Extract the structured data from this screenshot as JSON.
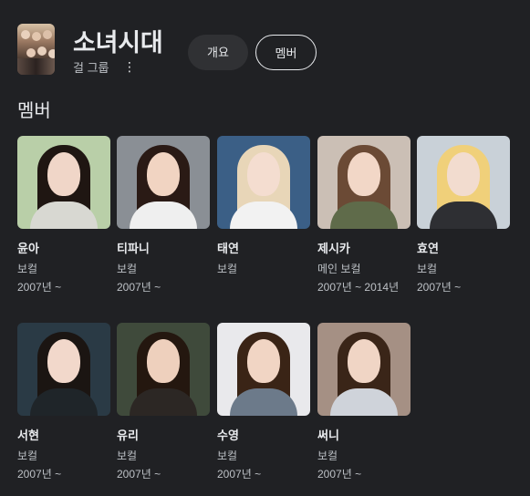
{
  "group": {
    "name": "소녀시대",
    "type": "걸 그룹",
    "more_icon": "⋮"
  },
  "chips": {
    "overview": "개요",
    "members": "멤버"
  },
  "section_title": "멤버",
  "members": [
    {
      "name": "윤아",
      "role": "보컬",
      "years": "2007년 ~",
      "bg": "#b9cfa8",
      "hair": "#1f1612",
      "face": "#f0d6c8",
      "body": "#d8d8d2"
    },
    {
      "name": "티파니",
      "role": "보컬",
      "years": "2007년 ~",
      "bg": "#8a8f95",
      "hair": "#2a1a15",
      "face": "#f1d4c2",
      "body": "#efefef"
    },
    {
      "name": "태연",
      "role": "보컬",
      "years": "",
      "bg": "#3b5f86",
      "hair": "#e8d6b8",
      "face": "#f4ddd0",
      "body": "#f2f2f2"
    },
    {
      "name": "제시카",
      "role": "메인 보컬",
      "years": "2007년 ~ 2014년",
      "bg": "#cbbfb5",
      "hair": "#6b4a35",
      "face": "#f2d7c7",
      "body": "#5f6b4a"
    },
    {
      "name": "효연",
      "role": "보컬",
      "years": "2007년 ~",
      "bg": "#c9d1d8",
      "hair": "#f0d07a",
      "face": "#f2dccf",
      "body": "#2e2f33"
    },
    {
      "name": "서현",
      "role": "보컬",
      "years": "2007년 ~",
      "bg": "#2a3a45",
      "hair": "#1b1512",
      "face": "#f2d8cb",
      "body": "#1f2529"
    },
    {
      "name": "유리",
      "role": "보컬",
      "years": "2007년 ~",
      "bg": "#3f4a3b",
      "hair": "#24170f",
      "face": "#eed0bd",
      "body": "#2c2724"
    },
    {
      "name": "수영",
      "role": "보컬",
      "years": "2007년 ~",
      "bg": "#e9e9ec",
      "hair": "#3a2416",
      "face": "#f1d5c4",
      "body": "#6c7a8a"
    },
    {
      "name": "써니",
      "role": "보컬",
      "years": "2007년 ~",
      "bg": "#a59084",
      "hair": "#3a2518",
      "face": "#f0d5c5",
      "body": "#cfd3da"
    }
  ]
}
